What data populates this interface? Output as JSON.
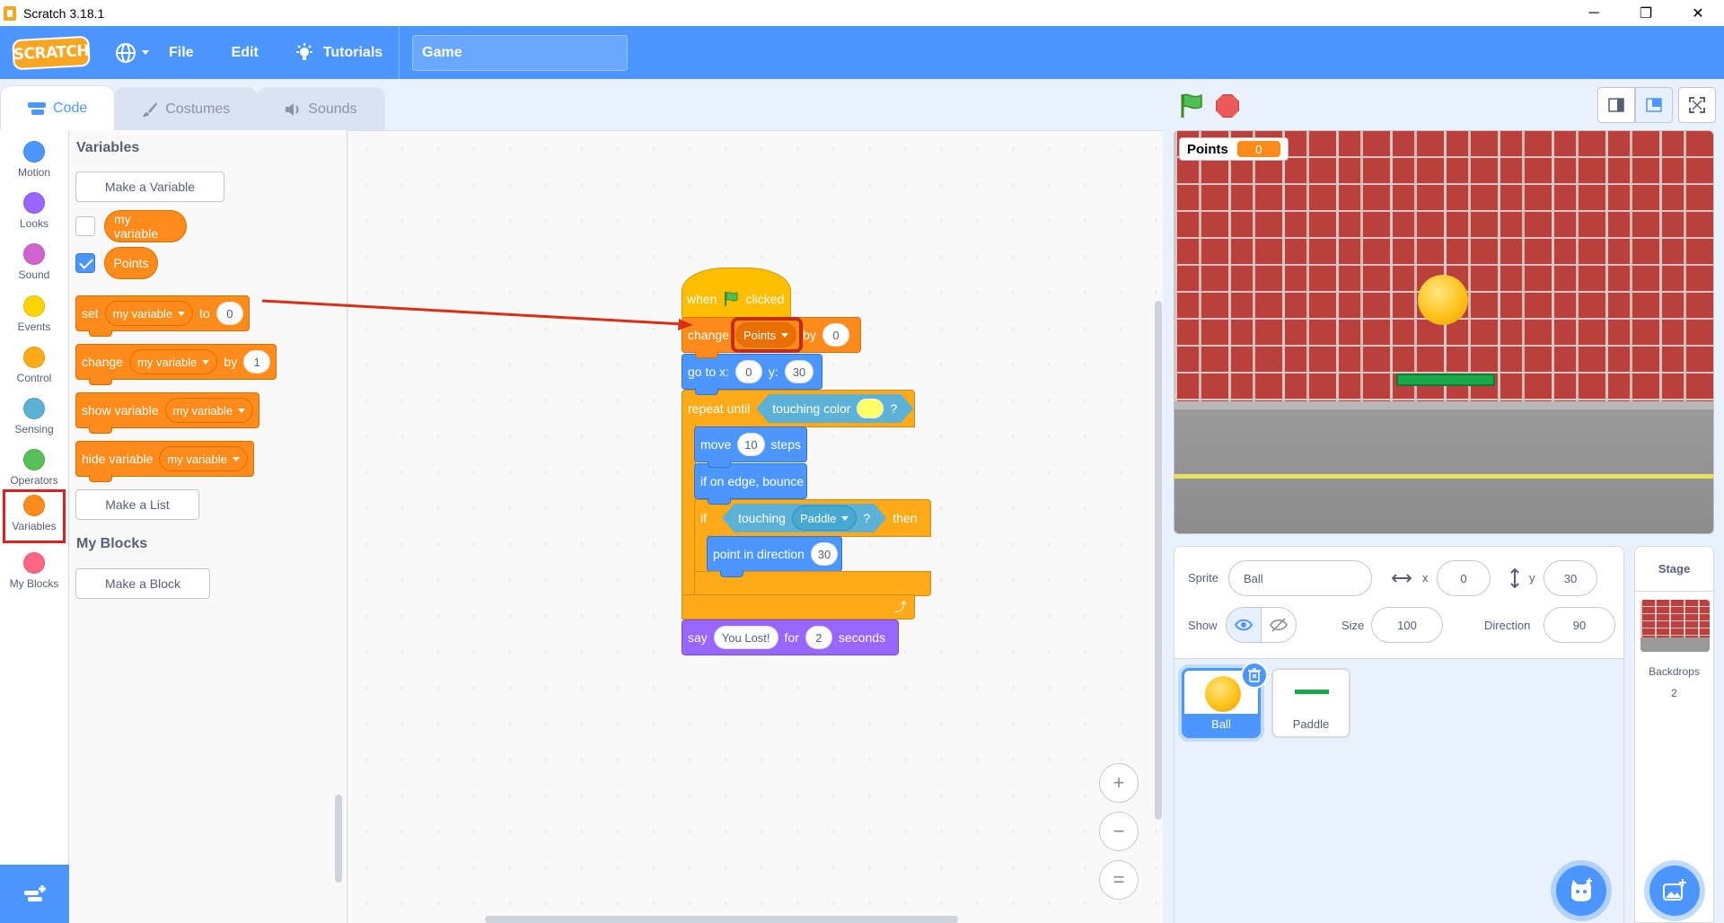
{
  "window": {
    "title": "Scratch 3.18.1",
    "minimize": "─",
    "restore": "❐",
    "close": "✕"
  },
  "menubar": {
    "logo": "SCRATCH",
    "file": "File",
    "edit": "Edit",
    "tutorials": "Tutorials",
    "project_title": "Game"
  },
  "tabs": [
    {
      "label": "Code"
    },
    {
      "label": "Costumes"
    },
    {
      "label": "Sounds"
    }
  ],
  "categories": [
    {
      "label": "Motion",
      "color": "#4c97ff"
    },
    {
      "label": "Looks",
      "color": "#9966ff"
    },
    {
      "label": "Sound",
      "color": "#cf63cf"
    },
    {
      "label": "Events",
      "color": "#ffd500"
    },
    {
      "label": "Control",
      "color": "#ffab19"
    },
    {
      "label": "Sensing",
      "color": "#5cb1d6"
    },
    {
      "label": "Operators",
      "color": "#59c059"
    },
    {
      "label": "Variables",
      "color": "#ff8c1a"
    },
    {
      "label": "My Blocks",
      "color": "#ff6680"
    }
  ],
  "palette": {
    "variables_heading": "Variables",
    "make_variable": "Make a Variable",
    "var1": "my variable",
    "var2": "Points",
    "set_block": {
      "label": "set",
      "var": "my variable",
      "to": "to",
      "value": "0"
    },
    "change_block": {
      "label": "change",
      "var": "my variable",
      "by": "by",
      "value": "1"
    },
    "show_block": {
      "label": "show variable",
      "var": "my variable"
    },
    "hide_block": {
      "label": "hide variable",
      "var": "my variable"
    },
    "make_list": "Make a List",
    "myblocks_heading": "My Blocks",
    "make_block": "Make a Block"
  },
  "script": {
    "hat": {
      "when": "when",
      "clicked": "clicked"
    },
    "change": {
      "label": "change",
      "var": "Points",
      "by": "by",
      "value": "0"
    },
    "goto": {
      "label": "go to x:",
      "x": "0",
      "ylabel": "y:",
      "y": "30"
    },
    "repeat": {
      "label": "repeat until",
      "cond": "touching color",
      "q": "?"
    },
    "move": {
      "label": "move",
      "value": "10",
      "steps": "steps"
    },
    "bounce": {
      "label": "if on edge, bounce"
    },
    "if": {
      "label": "if",
      "cond": "touching",
      "target": "Paddle",
      "q": "?",
      "then": "then"
    },
    "point": {
      "label": "point in direction",
      "value": "30"
    },
    "say": {
      "label": "say",
      "text": "You Lost!",
      "for": "for",
      "secs": "2",
      "seconds": "seconds"
    }
  },
  "zoom": {
    "in": "+",
    "out": "−",
    "reset": "="
  },
  "stage": {
    "monitor_label": "Points",
    "monitor_value": "0"
  },
  "sprite_info": {
    "sprite_label": "Sprite",
    "sprite_name": "Ball",
    "x_label": "x",
    "x": "0",
    "y_label": "y",
    "y": "30",
    "show_label": "Show",
    "size_label": "Size",
    "size": "100",
    "direction_label": "Direction",
    "direction": "90"
  },
  "sprites": [
    {
      "name": "Ball"
    },
    {
      "name": "Paddle"
    }
  ],
  "stage_pane": {
    "title": "Stage",
    "backdrops_label": "Backdrops",
    "backdrops_count": "2"
  }
}
